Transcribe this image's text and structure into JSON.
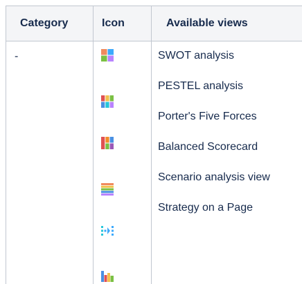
{
  "table": {
    "headers": {
      "category": "Category",
      "icon": "Icon",
      "views": "Available views"
    },
    "category_value": "-",
    "icons": [
      {
        "name": "swot-analysis-icon",
        "colors": [
          "#f08a5d",
          "#3da9fc",
          "#7bc043",
          "#b983ff"
        ]
      },
      {
        "name": "pestel-analysis-icon",
        "colors": [
          "#e05252",
          "#f2c14e",
          "#7bc043",
          "#4a90e2",
          "#26c6da",
          "#b983ff"
        ]
      },
      {
        "name": "porters-five-forces-icon",
        "colors": [
          "#e05252",
          "#f28c28",
          "#7bc043",
          "#4a90e2",
          "#9b59b6"
        ]
      },
      {
        "name": "balanced-scorecard-icon",
        "colors": [
          "#f08a5d",
          "#f2c14e",
          "#7bc043",
          "#4a90e2",
          "#b983ff"
        ]
      },
      {
        "name": "scenario-analysis-icon",
        "colors": [
          "#26c6da",
          "#3da9fc"
        ]
      },
      {
        "name": "strategy-on-a-page-icon",
        "colors": [
          "#4a90e2",
          "#e05252",
          "#f2c14e",
          "#7bc043"
        ]
      }
    ],
    "views": [
      "SWOT analysis",
      "PESTEL analysis",
      "Porter's Five Forces",
      "Balanced Scorecard",
      "Scenario analysis view",
      "Strategy on a Page"
    ]
  }
}
